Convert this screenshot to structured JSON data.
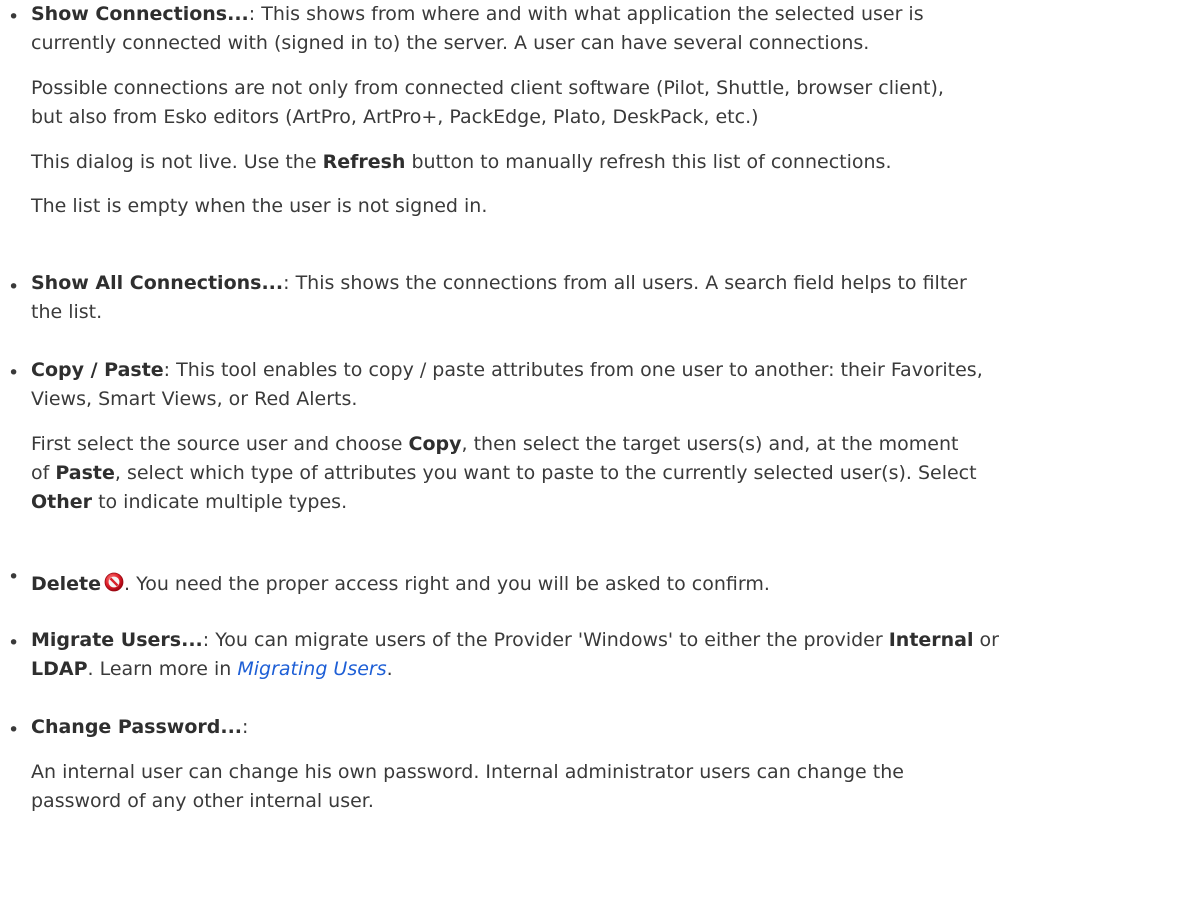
{
  "items": {
    "show_connections": {
      "title": "Show Connections...",
      "rest": ": This shows from where and with what application the selected user is",
      "line2": "currently connected with (signed in to) the server. A user can have several connections.",
      "para2_line1": "Possible connections are not only from connected client software (Pilot, Shuttle, browser client),",
      "para2_line2": "but also from Esko editors (ArtPro, ArtPro+, PackEdge, Plato, DeskPack, etc.)",
      "para3_pre": "This dialog is not live. Use the ",
      "para3_bold": "Refresh",
      "para3_post": " button to manually refresh this list of connections.",
      "para4": "The list is empty when the user is not signed in."
    },
    "show_all_connections": {
      "title": "Show All Connections...",
      "rest": ": This shows the connections from all users. A search field helps to filter",
      "line2": "the list."
    },
    "copy_paste": {
      "title": "Copy / Paste",
      "rest": ": This tool enables to copy / paste attributes from one user to another: their Favorites,",
      "line2": "Views, Smart Views, or Red Alerts.",
      "para2_pre": "First select the source user and choose ",
      "para2_bold1": "Copy",
      "para2_mid": ", then select the target users(s) and, at the moment",
      "para2_l2_pre": "of ",
      "para2_bold2": "Paste",
      "para2_l2_post": ", select which type of attributes you want to paste to the currently selected user(s). Select",
      "para2_bold3": "Other",
      "para2_l3_post": " to indicate multiple types."
    },
    "delete": {
      "title": "Delete",
      "rest": ". You need the proper access right and you will be asked to confirm."
    },
    "migrate": {
      "title": "Migrate Users...",
      "rest": ": You can migrate users of the Provider 'Windows' to either the provider ",
      "bold_internal": "Internal",
      "or": " or",
      "bold_ldap": "LDAP",
      "learn_pre": ". Learn more in ",
      "link": "Migrating Users",
      "link_post": "."
    },
    "change_password": {
      "title": "Change Password...",
      "rest": ":",
      "para2_line1": "An internal user can change his own password. Internal administrator users can change the",
      "para2_line2": "password of any other internal user."
    }
  },
  "bullet_char": "•",
  "colors": {
    "text": "#3a3a3a",
    "link": "#1e5fd6",
    "delete_icon": "#e0202a"
  },
  "icons": {
    "delete": "no-entry-icon"
  }
}
